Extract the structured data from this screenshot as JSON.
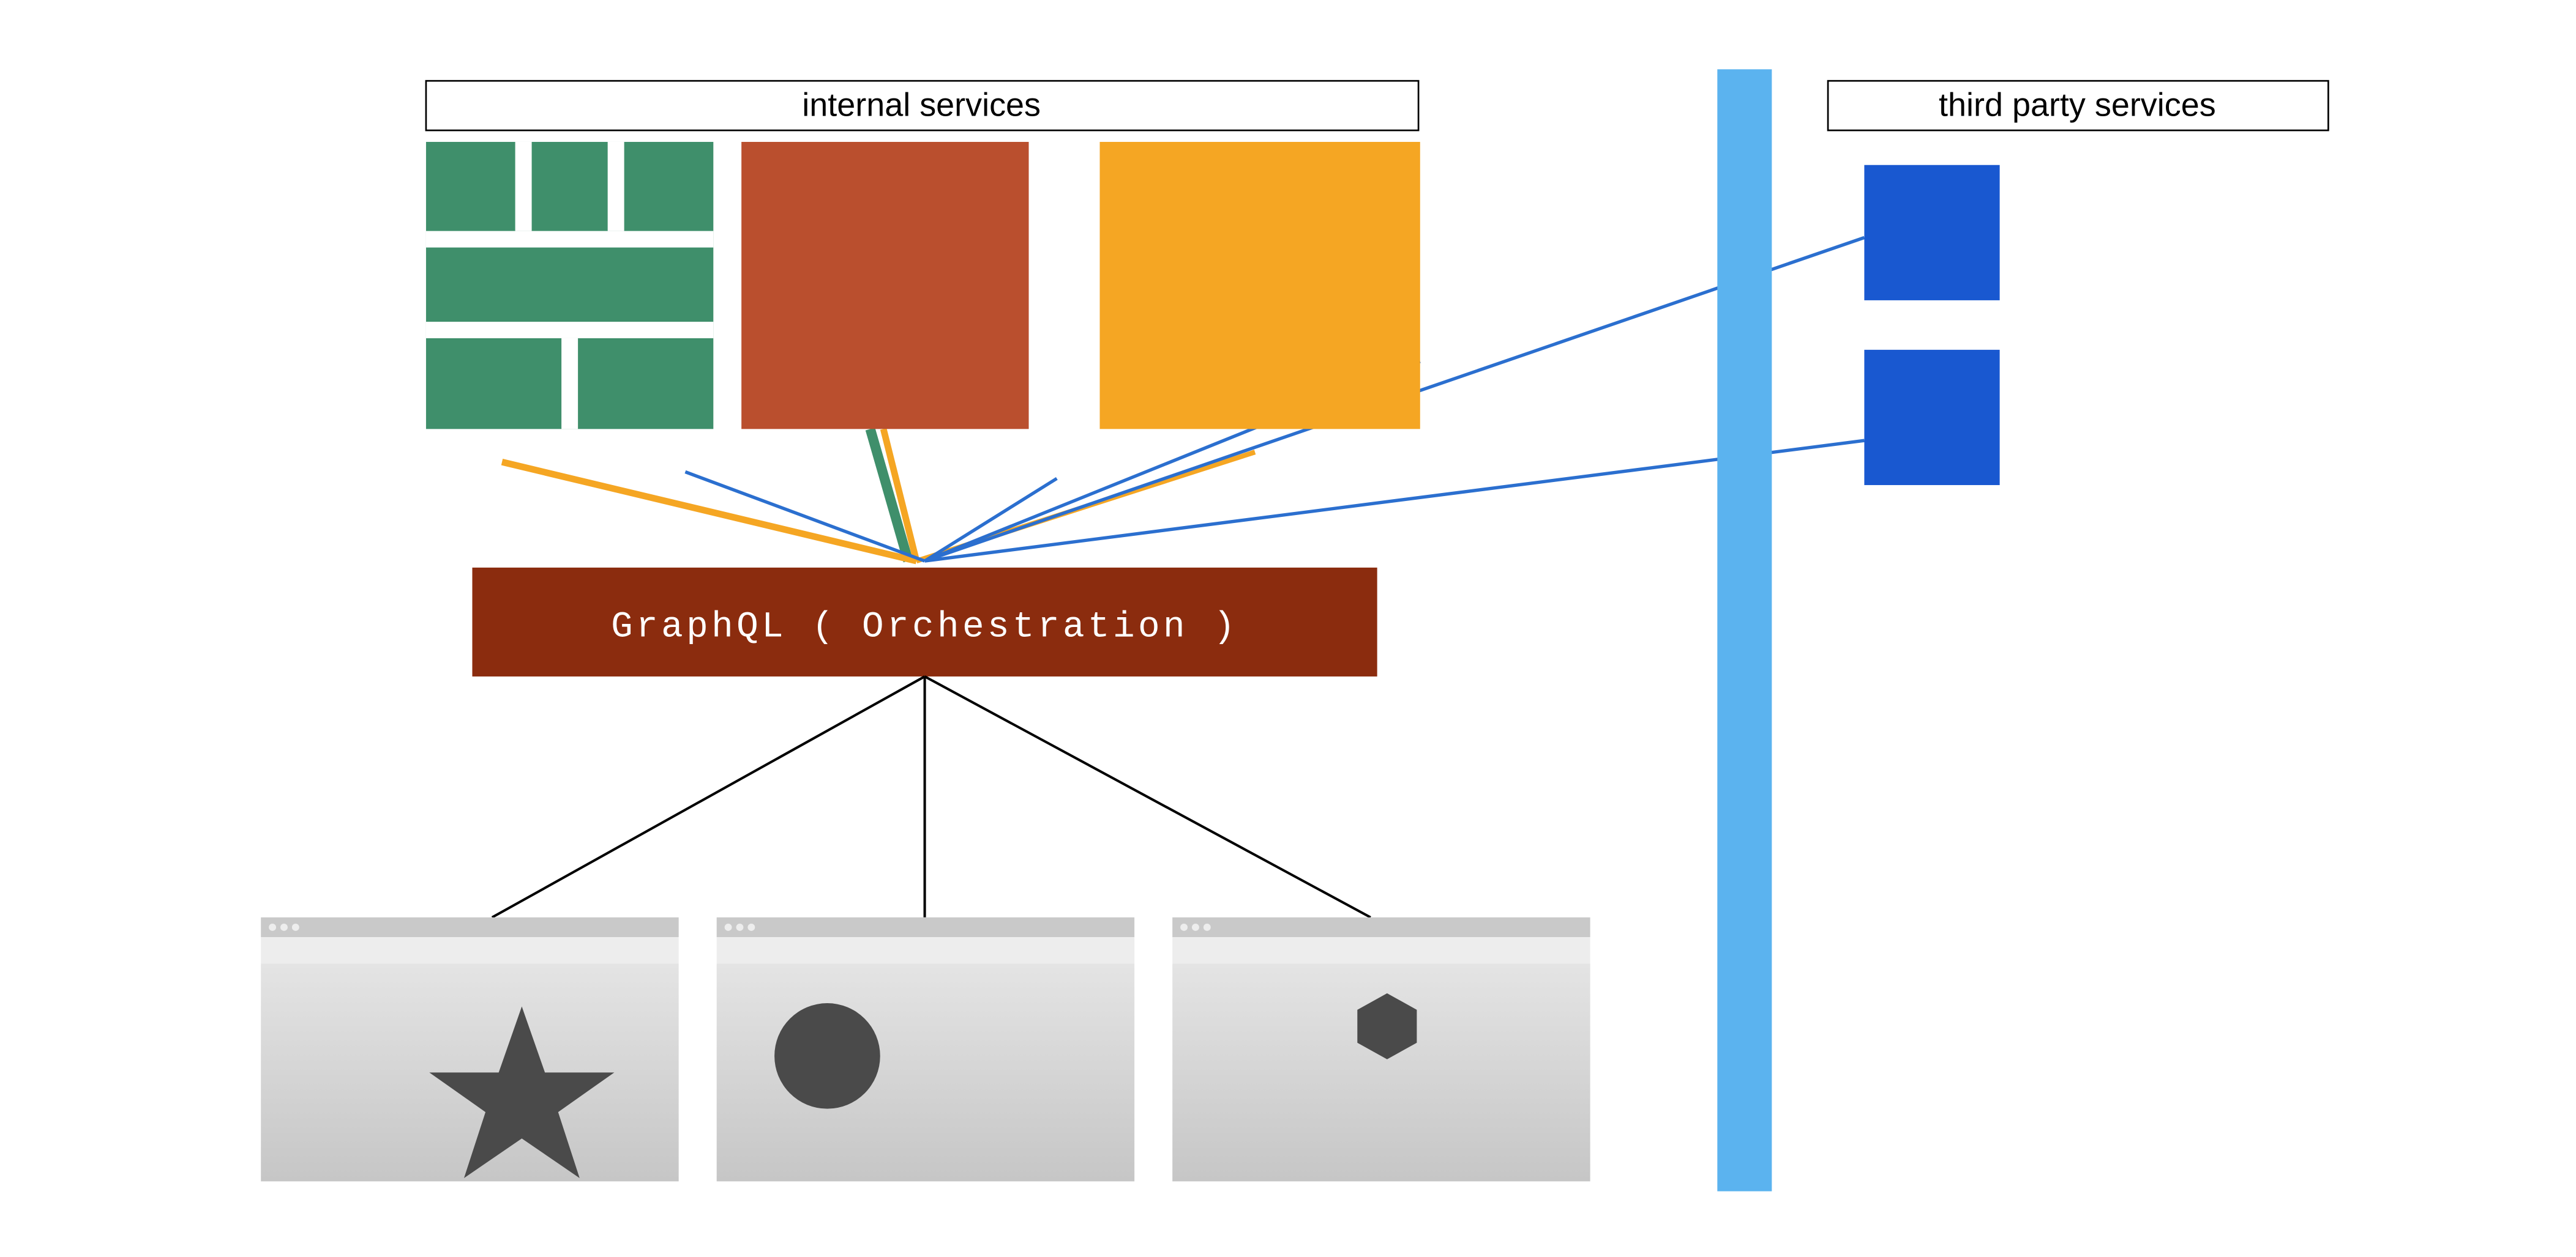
{
  "labels": {
    "internal": "internal services",
    "thirdparty": "third party services",
    "graphql": "GraphQL ( Orchestration )"
  },
  "colors": {
    "green": "#3F8F6B",
    "rust": "#BA4F2E",
    "orange": "#F5A623",
    "graphql_bg": "#8B2C0E",
    "barrier": "#5BB3EF",
    "blue_box": "#1958D0",
    "line_blue": "#2B6FCF",
    "line_orange": "#F5A623",
    "line_green": "#3F8F6B",
    "line_black": "#000000",
    "browser_frame": "#C9C9C9",
    "browser_body_top": "#E4E4E4",
    "browser_body_bot": "#C8C8C8",
    "shape": "#4A4A4A"
  },
  "structure": {
    "internal_services": [
      "green-brick-service",
      "rust-service",
      "orange-service"
    ],
    "third_party_services": [
      "blue-service-1",
      "blue-service-2"
    ],
    "clients": [
      "star-client",
      "circle-client",
      "hexagon-client"
    ]
  }
}
